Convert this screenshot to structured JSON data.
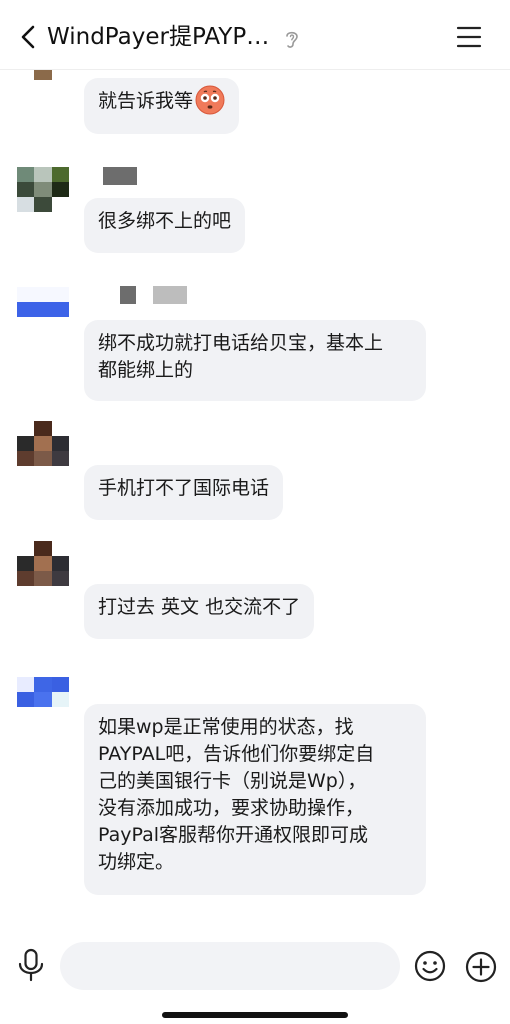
{
  "header": {
    "title": "WindPayer提PAYP…",
    "back_icon": "chevron-left-icon",
    "ear_icon": "ear-icon",
    "menu_icon": "menu-icon"
  },
  "messages": [
    {
      "text": "就告诉我等",
      "emoji": "flushed-face-emoji"
    },
    {
      "text": "很多绑不上的吧"
    },
    {
      "text": "绑不成功就打电话给贝宝，基本上\n都能绑上的"
    },
    {
      "text": "手机打不了国际电话"
    },
    {
      "text": "打过去  英文  也交流不了"
    },
    {
      "text": "如果wp是正常使用的状态，找\nPAYPAL吧，告诉他们你要绑定自\n己的美国银行卡（别说是Wp），\n没有添加成功，要求协助操作，\nPayPal客服帮你开通权限即可成\n功绑定。"
    }
  ],
  "input_bar": {
    "placeholder": "",
    "mic_icon": "microphone-icon",
    "emoji_icon": "smiley-icon",
    "plus_icon": "plus-circle-icon"
  },
  "colors": {
    "bubble_bg": "#f1f2f5",
    "header_border": "#eeeeee",
    "input_bg": "#f2f3f6"
  }
}
